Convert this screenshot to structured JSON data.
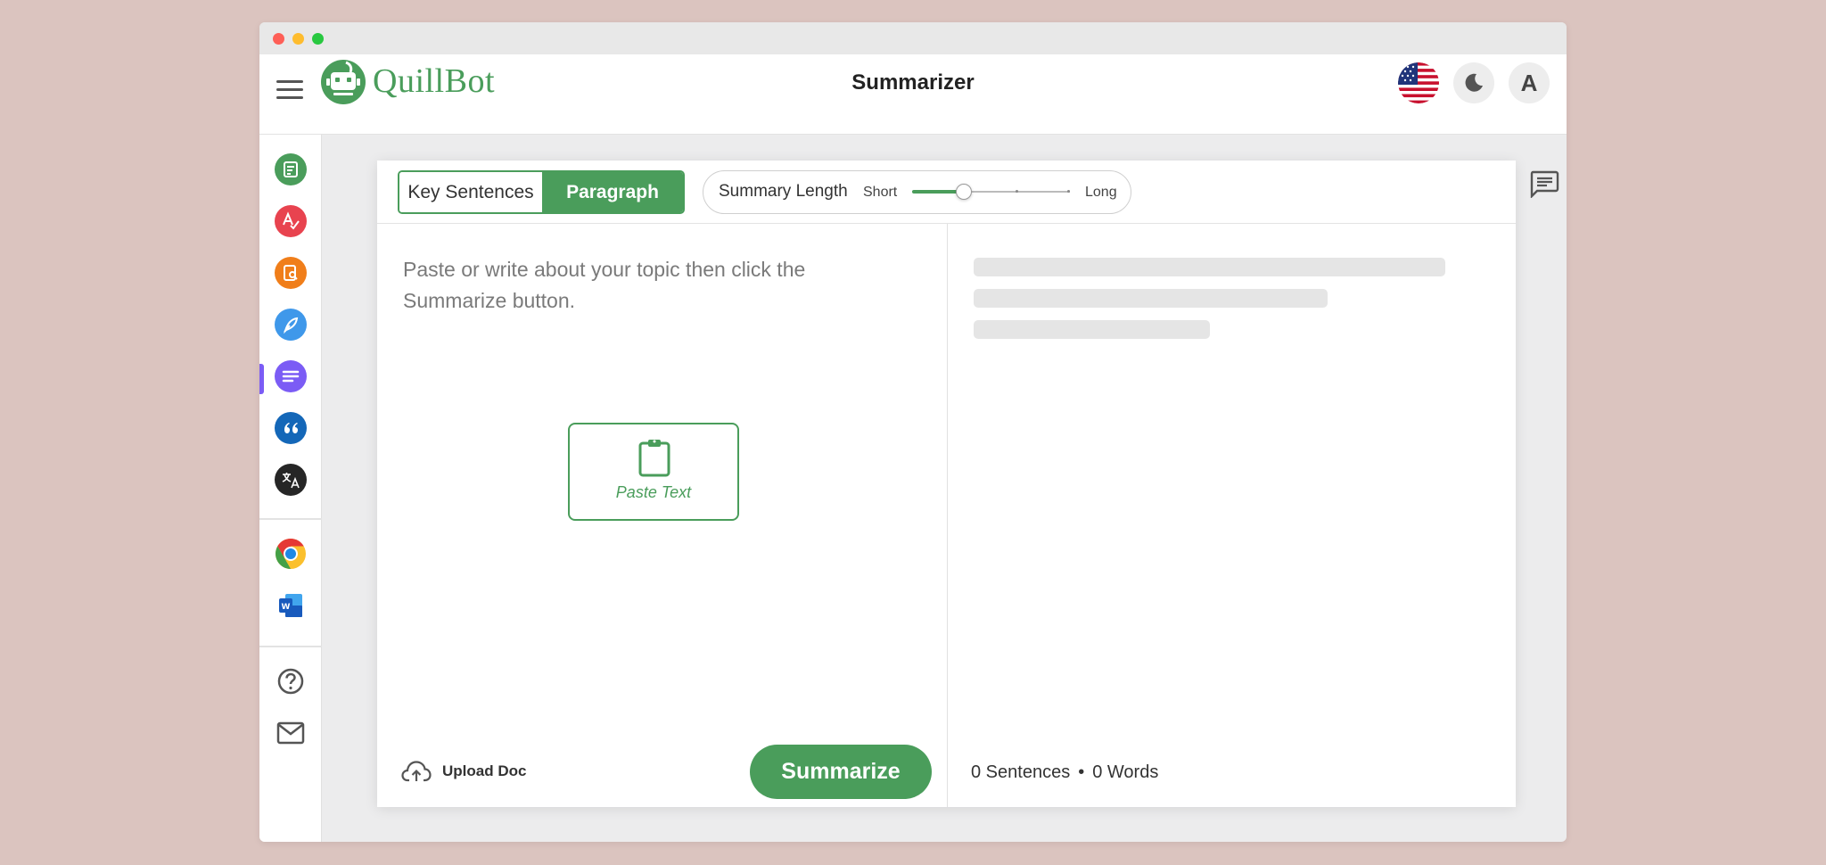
{
  "app": {
    "logo_text": "QuillBot",
    "title": "Summarizer"
  },
  "header": {
    "avatar_initial": "A",
    "icons": [
      "menu-icon",
      "us-flag-icon",
      "moon-icon"
    ]
  },
  "sidebar": {
    "items": [
      {
        "name": "paraphraser",
        "icon": "paraphraser-icon",
        "color": "#4a9d5b"
      },
      {
        "name": "grammar-checker",
        "icon": "grammar-check-icon",
        "color": "#e8434f"
      },
      {
        "name": "plagiarism-checker",
        "icon": "plagiarism-icon",
        "color": "#f07e1a"
      },
      {
        "name": "co-writer",
        "icon": "pen-icon",
        "color": "#3f98ea"
      },
      {
        "name": "summarizer",
        "icon": "summarizer-icon",
        "color": "#7b5cf5",
        "active": true
      },
      {
        "name": "citation-generator",
        "icon": "quote-icon",
        "color": "#1467b8"
      },
      {
        "name": "translator",
        "icon": "translate-icon",
        "color": "#262626"
      }
    ],
    "extensions": [
      "chrome-icon",
      "word-icon"
    ],
    "footer": [
      "help-icon",
      "mail-icon"
    ]
  },
  "toolbar": {
    "modes": [
      "Key Sentences",
      "Paragraph"
    ],
    "active_mode": "Paragraph",
    "length_label": "Summary Length",
    "short_label": "Short",
    "long_label": "Long",
    "length_value": 0.33
  },
  "editor": {
    "placeholder": "Paste or write about your topic then click the Summarize button.",
    "paste_label": "Paste Text",
    "upload_label": "Upload Doc",
    "summarize_label": "Summarize"
  },
  "output": {
    "stats": {
      "sentences": "0 Sentences",
      "separator": "•",
      "words": "0 Words"
    }
  },
  "colors": {
    "brand": "#4a9d5b",
    "background": "#dbc4bf",
    "summarizer_active": "#7b5cf5"
  }
}
